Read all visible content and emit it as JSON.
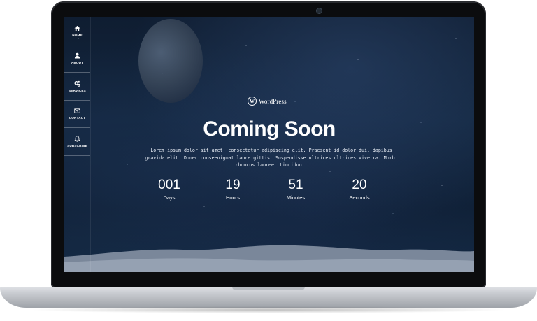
{
  "sidebar": {
    "items": [
      {
        "label": "HOME",
        "icon": "home-icon"
      },
      {
        "label": "ABOUT",
        "icon": "user-icon"
      },
      {
        "label": "SERVICES",
        "icon": "gears-icon"
      },
      {
        "label": "CONTACT",
        "icon": "envelope-icon"
      },
      {
        "label": "SUBSCRIBE",
        "icon": "bell-icon"
      }
    ]
  },
  "logo": {
    "mark": "W",
    "text": "WordPress"
  },
  "hero": {
    "title": "Coming Soon",
    "description": "Lorem ipsum dolor sit amet, consectetur adipiscing elit. Praesent id dolor dui, dapibus gravida elit. Donec conseenigmat laore gittis. Suspendisse ultrices ultrices viverra. Morbi rhoncus laoreet tincidunt."
  },
  "countdown": [
    {
      "value": "001",
      "label": "Days"
    },
    {
      "value": "19",
      "label": "Hours"
    },
    {
      "value": "51",
      "label": "Minutes"
    },
    {
      "value": "20",
      "label": "Seconds"
    }
  ],
  "colors": {
    "sky": "#132740",
    "text": "#ffffff",
    "bezel": "#0b0c0e",
    "ground": "#8e9aab"
  }
}
